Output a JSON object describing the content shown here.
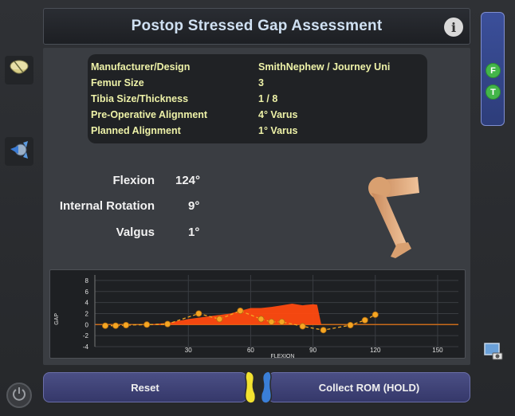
{
  "title": "Postop Stressed Gap Assessment",
  "info_button": {
    "icon": "info-icon",
    "glyph": "i"
  },
  "specs": [
    {
      "label": "Manufacturer/Design",
      "value": "SmithNephew / Journey Uni"
    },
    {
      "label": "Femur Size",
      "value": "3"
    },
    {
      "label": "Tibia Size/Thickness",
      "value": "1 / 8"
    },
    {
      "label": "Pre-Operative Alignment",
      "value": "4° Varus"
    },
    {
      "label": "Planned Alignment",
      "value": "1° Varus"
    }
  ],
  "readouts": [
    {
      "label": "Flexion",
      "value": "124°"
    },
    {
      "label": "Internal Rotation",
      "value": "9°"
    },
    {
      "label": "Valgus",
      "value": "1°"
    }
  ],
  "right_panel": {
    "badges": [
      "F",
      "T"
    ]
  },
  "buttons": {
    "reset": "Reset",
    "collect": "Collect ROM (HOLD)"
  },
  "icons": {
    "implant": "knee-implant-icon",
    "robot": "robot-arm-icon",
    "power": "power-icon",
    "screenshot": "screenshot-icon",
    "feet": "footprints-icon"
  },
  "colors": {
    "accent_fill": "#ff4a10",
    "point": "#f5a623",
    "badge": "#43b649",
    "spec_text": "#eef2a8"
  },
  "chart_data": {
    "type": "area",
    "xlabel": "FLEXION",
    "ylabel": "GAP",
    "xlim": [
      -15,
      160
    ],
    "ylim": [
      -4,
      9
    ],
    "xticks": [
      "30",
      "60",
      "90",
      "120",
      "150"
    ],
    "yticks": [
      "8",
      "6",
      "4",
      "2",
      "0",
      "-2",
      "-4"
    ],
    "area": {
      "x": [
        0,
        10,
        20,
        30,
        40,
        50,
        55,
        60,
        65,
        70,
        75,
        80,
        85,
        90,
        92,
        94
      ],
      "y": [
        0,
        0,
        0.3,
        1.0,
        1.5,
        2.0,
        2.5,
        3.0,
        3.0,
        3.2,
        3.5,
        3.8,
        3.5,
        3.7,
        3.6,
        0
      ]
    },
    "points": {
      "x": [
        -10,
        -5,
        0,
        10,
        20,
        35,
        45,
        55,
        65,
        70,
        75,
        85,
        95,
        108,
        115,
        120
      ],
      "y": [
        -0.2,
        -0.2,
        -0.1,
        0,
        0.1,
        2.0,
        1.0,
        2.5,
        1.0,
        0.5,
        0.5,
        -0.3,
        -1.0,
        -0.1,
        0.8,
        1.8
      ]
    }
  }
}
